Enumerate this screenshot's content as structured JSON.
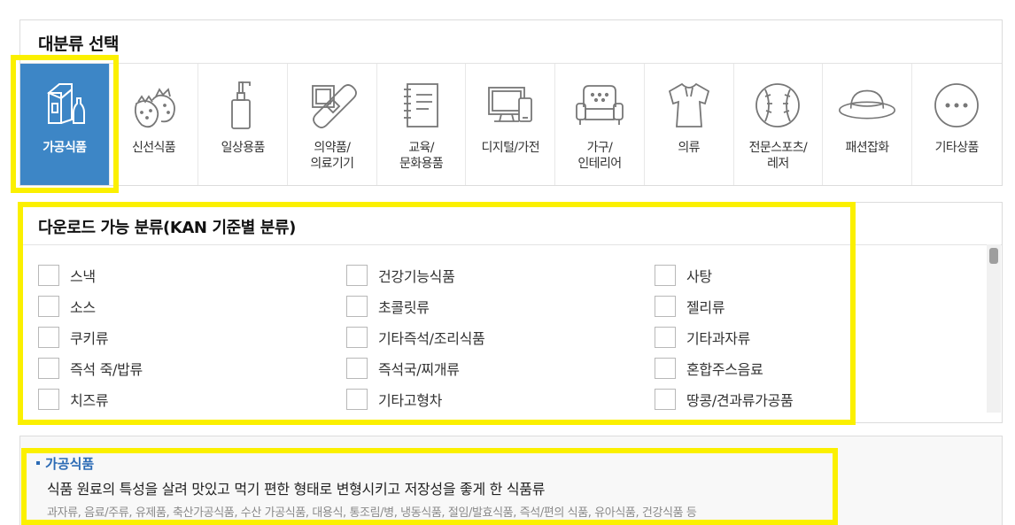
{
  "category_section": {
    "title": "대분류 선택",
    "items": [
      {
        "label": "가공식품",
        "icon": "processed-food-icon",
        "active": true
      },
      {
        "label": "신선식품",
        "icon": "strawberry-icon",
        "active": false
      },
      {
        "label": "일상용품",
        "icon": "pump-bottle-icon",
        "active": false
      },
      {
        "label": "의약품/\n의료기기",
        "icon": "bandage-icon",
        "active": false
      },
      {
        "label": "교육/\n문화용품",
        "icon": "notebook-icon",
        "active": false
      },
      {
        "label": "디지털/가전",
        "icon": "monitor-phone-icon",
        "active": false
      },
      {
        "label": "가구/\n인테리어",
        "icon": "sofa-icon",
        "active": false
      },
      {
        "label": "의류",
        "icon": "shirt-icon",
        "active": false
      },
      {
        "label": "전문스포츠/\n레저",
        "icon": "baseball-icon",
        "active": false
      },
      {
        "label": "패션잡화",
        "icon": "hat-icon",
        "active": false
      },
      {
        "label": "기타상품",
        "icon": "more-dots-icon",
        "active": false
      }
    ]
  },
  "subcategory_section": {
    "title": "다운로드 가능 분류(KAN 기준별 분류)",
    "items": [
      {
        "label": "스낵",
        "checked": false
      },
      {
        "label": "건강기능식품",
        "checked": false
      },
      {
        "label": "사탕",
        "checked": false
      },
      {
        "label": "소스",
        "checked": false
      },
      {
        "label": "초콜릿류",
        "checked": false
      },
      {
        "label": "젤리류",
        "checked": false
      },
      {
        "label": "쿠키류",
        "checked": false
      },
      {
        "label": "기타즉석/조리식품",
        "checked": false
      },
      {
        "label": "기타과자류",
        "checked": false
      },
      {
        "label": "즉석 죽/밥류",
        "checked": false
      },
      {
        "label": "즉석국/찌개류",
        "checked": false
      },
      {
        "label": "혼합주스음료",
        "checked": false
      },
      {
        "label": "치즈류",
        "checked": false
      },
      {
        "label": "기타고형차",
        "checked": false
      },
      {
        "label": "땅콩/견과류가공품",
        "checked": false
      }
    ]
  },
  "description": {
    "heading": "가공식품",
    "main": "식품 원료의 특성을 살려 맛있고 먹기 편한 형태로 변형시키고 저장성을 좋게 한 식품류",
    "examples": "과자류, 음료/주류, 유제품, 축산가공식품, 수산 가공식품, 대용식, 통조림/병, 냉동식품, 절임/발효식품, 즉석/편의 식품, 유아식품, 건강식품 등"
  },
  "colors": {
    "active_category": "#3d86c6",
    "highlight": "#fbf000",
    "description_heading": "#2c6bb5"
  }
}
